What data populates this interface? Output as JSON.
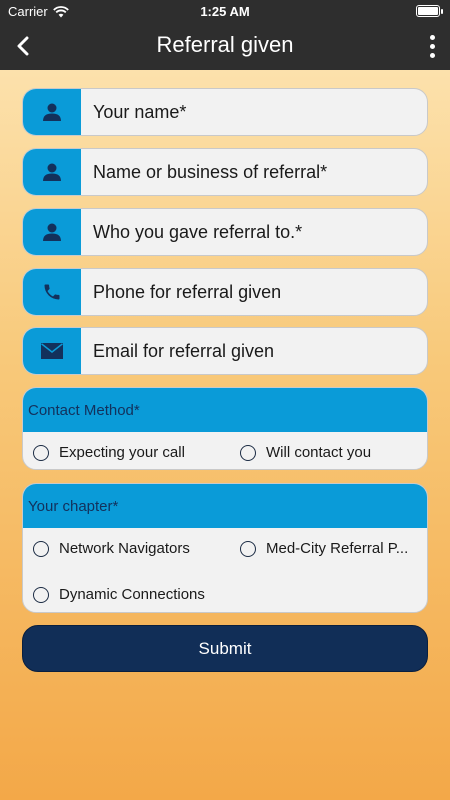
{
  "status_bar": {
    "carrier": "Carrier",
    "time": "1:25 AM"
  },
  "nav": {
    "title": "Referral given"
  },
  "fields": [
    {
      "label": "Your name*",
      "icon": "person-icon"
    },
    {
      "label": "Name or business of referral*",
      "icon": "person-icon"
    },
    {
      "label": "Who you gave referral to.*",
      "icon": "person-icon"
    },
    {
      "label": "Phone for referral given",
      "icon": "phone-icon"
    },
    {
      "label": "Email for referral given",
      "icon": "envelope-icon"
    }
  ],
  "contact_method": {
    "heading": "Contact Method*",
    "options": [
      "Expecting your call",
      "Will contact you"
    ]
  },
  "chapter": {
    "heading": "Your chapter*",
    "options": [
      "Network Navigators",
      "Med-City Referral P...",
      "Dynamic Connections"
    ]
  },
  "submit_label": "Submit",
  "colors": {
    "accent": "#0a9bd8",
    "nav": "#2e2e2e",
    "submit": "#112e57",
    "heading_text": "#13315c"
  }
}
